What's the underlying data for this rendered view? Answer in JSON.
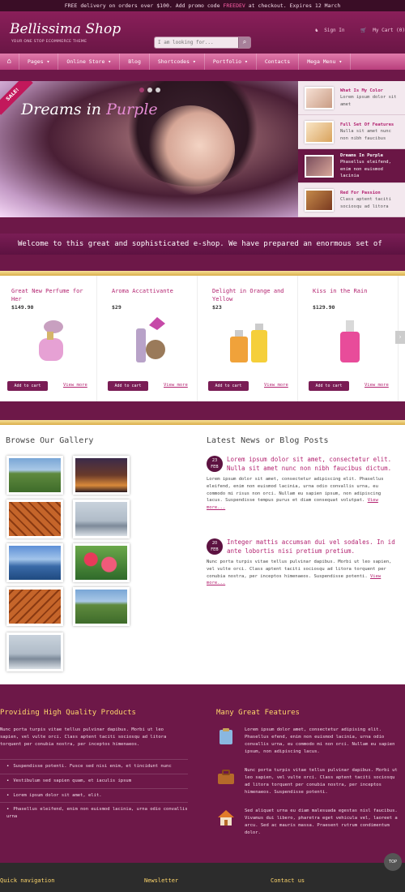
{
  "topbar": {
    "text_before": "FREE delivery on orders over $100. Add promo code ",
    "promo": "FREEDEV",
    "text_after": " at checkout. Expires 12 March"
  },
  "header": {
    "logo": "Bellissima Shop",
    "tagline": "YOUR ONE STOP ECOMMERCE THEME",
    "search_placeholder": "I am looking for...",
    "sign_in": "Sign In",
    "cart": "My Cart (0)"
  },
  "nav": {
    "items": [
      "Pages",
      "Online Store",
      "Blog",
      "Shortcodes",
      "Portfolio",
      "Contacts",
      "Mega Menu"
    ]
  },
  "slider": {
    "title_before": "Dreams in ",
    "title_accent": "Purple",
    "badge": "SALE!",
    "thumbs": [
      {
        "title": "What Is My Color",
        "text": "Lorem ipsum dolor sit amet"
      },
      {
        "title": "Full Set Of Features",
        "text": "Nulla sit amet nunc non nibh faucibus"
      },
      {
        "title": "Dreams In Purple",
        "text": "Phasellus eleifend, enim non euismod lacinia"
      },
      {
        "title": "Red For Passion",
        "text": "Class aptent taciti sociosqu ad litora"
      }
    ]
  },
  "welcome": "Welcome to this great and sophisticated e-shop. We have prepared an enormous set of",
  "products": [
    {
      "name": "Great New Perfume for Her",
      "price": "$149.90",
      "cart": "Add to cart",
      "more": "View more"
    },
    {
      "name": "Aroma Accattivante",
      "price": "$29",
      "cart": "Add to cart",
      "more": "View more"
    },
    {
      "name": "Delight in Orange and Yellow",
      "price": "$23",
      "cart": "Add to cart",
      "more": "View more"
    },
    {
      "name": "Kiss in the Rain",
      "price": "$129.90",
      "cart": "Add to cart",
      "more": "View more"
    }
  ],
  "gallery": {
    "title": "Browse Our Gallery"
  },
  "news": {
    "title": "Latest News or Blog Posts",
    "items": [
      {
        "day": "23",
        "month": "FEB",
        "head": "Lorem ipsum dolor sit amet, consectetur elit. Nulla sit amet nunc non nibh faucibus dictum.",
        "body": "Lorem ipsum dolor sit amet, consectetur adipiscing elit. Phasellus eleifend, enim non euismod lacinia, urna odio convallis urna, eu commodo mi risus non orci. Nullam eu sapien ipsum, non adipiscing lacus. Suspendisse tempus purus et diam consequat volutpat.",
        "more": "View more..."
      },
      {
        "day": "20",
        "month": "FEB",
        "head": "Integer mattis accumsan dui vel sodales. In id ante lobortis nisi pretium pretium.",
        "body": "Nunc porta turpis vitae tellus pulvinar dapibus. Morbi ut leo sapien, vel vulte orci. Class aptent taciti sociosqu ad litora torquent per conubia nostra, per inceptos himenaeos. Suspendisse potenti.",
        "more": "View more..."
      }
    ]
  },
  "footer": {
    "quality_title": "Providing High Quality Products",
    "quality_text": "Nunc porta turpis vitae tellus pulvinar dapibus. Morbi ut leo sapien, vel vulte orci. Class aptent taciti sociosqu ad litora torquent per conubia nostra, per inceptos himenaeos.",
    "list": [
      "Suspendisse potenti. Fusce sed nisi enim, et tincidunt nunc",
      "Vestibulum sed sapien quam, et iaculis ipsum",
      "Lorem ipsum dolor sit amet, elit.",
      "Phasellus eleifend, enim non euismod lacinia, urna odio convallis urna"
    ],
    "features_title": "Many Great Features",
    "features": [
      "Lorem ipsum dolor amet, consectetur adipising elit. Phasellus efend, enim non euismod lacinia, urna odio convallis urna, eu commodo mi non orci. Nullam eu sapien ipsum, non adipiscing lacus.",
      "Nunc porta turpis vitae tellus pulvinar dapibus. Morbi ut leo sapien, vel vulte orci. Class aptent taciti sociosqu ad litora torquent per conubia nostra, per inceptos himenaeos. Suspendisse potenti.",
      "Sed aliquet urna eu diam malesuada egestas nisl faucibus. Vivamus dui libero, pharetra eget vehicula vel, laoreet a arcu. Sed ac mauris massa. Praesent rutrum condimentum dolor."
    ],
    "bottom_titles": [
      "Quick navigation",
      "Newsletter",
      "Contact us"
    ],
    "top_label": "TOP"
  }
}
